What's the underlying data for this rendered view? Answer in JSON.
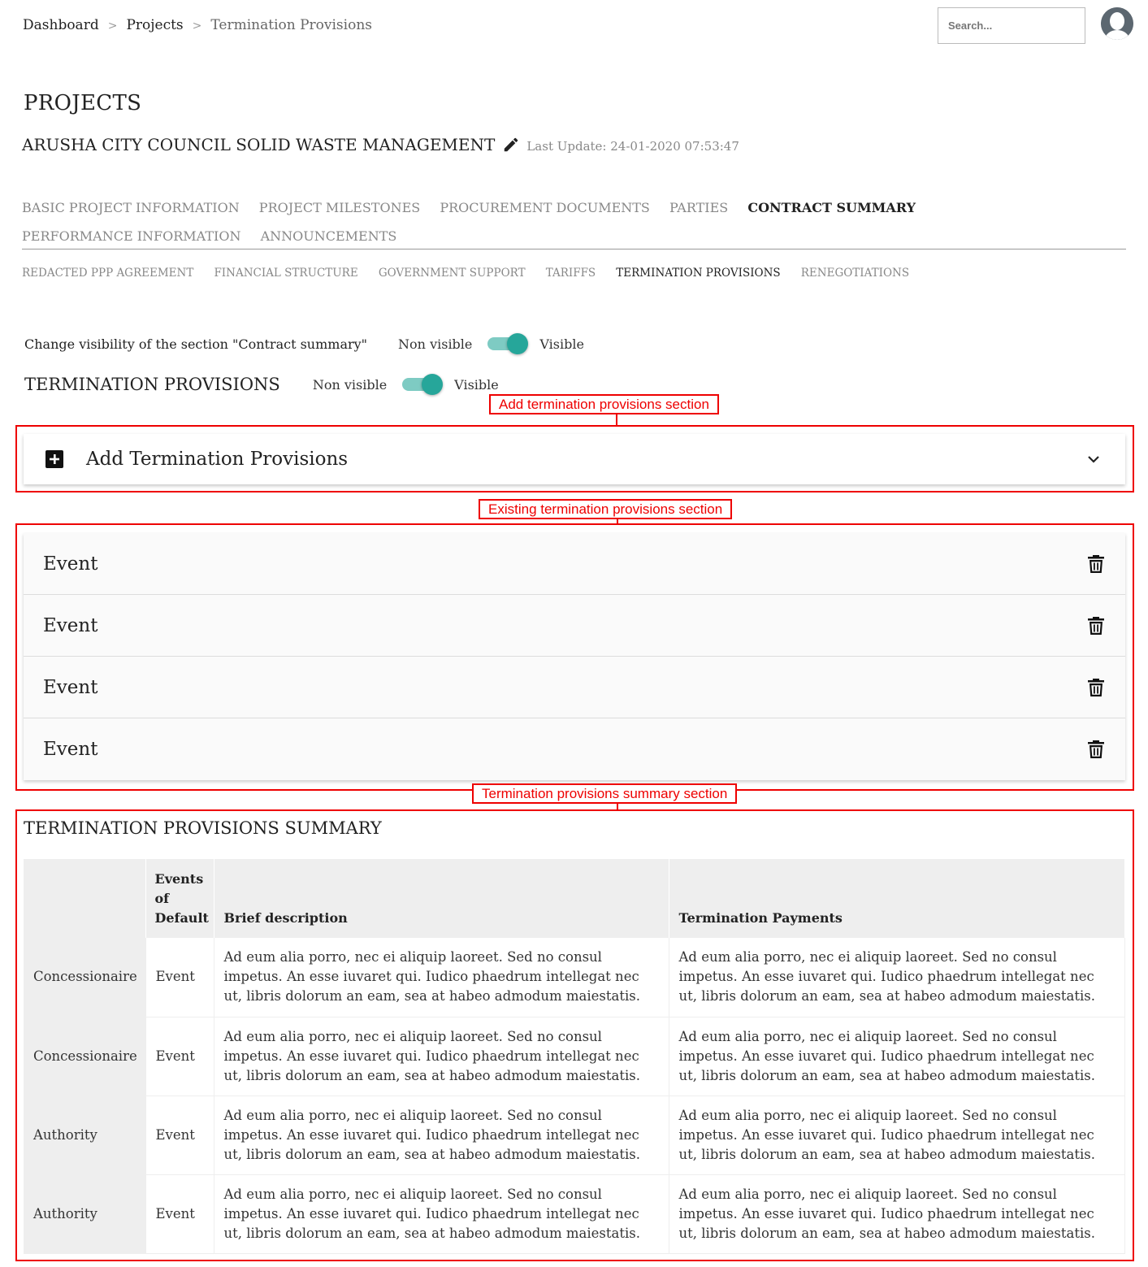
{
  "breadcrumb": {
    "items": [
      "Dashboard",
      "Projects",
      "Termination Provisions"
    ],
    "separator": ">"
  },
  "search": {
    "placeholder": "Search..."
  },
  "page": {
    "title": "PROJECTS",
    "project_name": "ARUSHA CITY COUNCIL SOLID WASTE MANAGEMENT",
    "last_update": "Last Update: 24-01-2020 07:53:47"
  },
  "main_tabs": [
    {
      "label": "BASIC PROJECT INFORMATION",
      "active": false
    },
    {
      "label": "PROJECT MILESTONES",
      "active": false
    },
    {
      "label": "PROCUREMENT DOCUMENTS",
      "active": false
    },
    {
      "label": "PARTIES",
      "active": false
    },
    {
      "label": "CONTRACT SUMMARY",
      "active": true
    },
    {
      "label": "PERFORMANCE INFORMATION",
      "active": false
    },
    {
      "label": "ANNOUNCEMENTS",
      "active": false
    }
  ],
  "sub_tabs": [
    {
      "label": "REDACTED PPP AGREEMENT",
      "active": false
    },
    {
      "label": "FINANCIAL STRUCTURE",
      "active": false
    },
    {
      "label": "GOVERNMENT SUPPORT",
      "active": false
    },
    {
      "label": "TARIFFS",
      "active": false
    },
    {
      "label": "TERMINATION PROVISIONS",
      "active": true
    },
    {
      "label": "RENEGOTIATIONS",
      "active": false
    }
  ],
  "visibility": {
    "label": "Change visibility of the section \"Contract summary\"",
    "off_label": "Non visible",
    "on_label": "Visible",
    "enabled": true
  },
  "section": {
    "title": "TERMINATION PROVISIONS",
    "off_label": "Non visible",
    "on_label": "Visible",
    "enabled": true
  },
  "annotations": {
    "add": "Add termination provisions section",
    "existing": "Existing termination provisions section",
    "summary": "Termination provisions summary section"
  },
  "add_panel": {
    "title": "Add Termination Provisions",
    "icon": "plus-square-icon",
    "chevron": "chevron-down-icon"
  },
  "events": [
    {
      "title": "Event"
    },
    {
      "title": "Event"
    },
    {
      "title": "Event"
    },
    {
      "title": "Event"
    }
  ],
  "summary": {
    "title": "TERMINATION PROVISIONS SUMMARY",
    "headers": [
      "",
      "Events of Default",
      "Brief description",
      "Termination Payments"
    ],
    "rows": [
      {
        "party": "Concessionaire",
        "event": "Event",
        "description": "Ad eum alia porro, nec ei aliquip laoreet. Sed no consul impetus. An esse iuvaret qui. Iudico phaedrum intellegat nec ut, libris dolorum an eam, sea at habeo admodum maiestatis.",
        "payments": "Ad eum alia porro, nec ei aliquip laoreet. Sed no consul impetus. An esse iuvaret qui. Iudico phaedrum intellegat nec ut, libris dolorum an eam, sea at habeo admodum maiestatis."
      },
      {
        "party": "Concessionaire",
        "event": "Event",
        "description": "Ad eum alia porro, nec ei aliquip laoreet. Sed no consul impetus. An esse iuvaret qui. Iudico phaedrum intellegat nec ut, libris dolorum an eam, sea at habeo admodum maiestatis.",
        "payments": "Ad eum alia porro, nec ei aliquip laoreet. Sed no consul impetus. An esse iuvaret qui. Iudico phaedrum intellegat nec ut, libris dolorum an eam, sea at habeo admodum maiestatis."
      },
      {
        "party": "Authority",
        "event": "Event",
        "description": "Ad eum alia porro, nec ei aliquip laoreet. Sed no consul impetus. An esse iuvaret qui. Iudico phaedrum intellegat nec ut, libris dolorum an eam, sea at habeo admodum maiestatis.",
        "payments": "Ad eum alia porro, nec ei aliquip laoreet. Sed no consul impetus. An esse iuvaret qui. Iudico phaedrum intellegat nec ut, libris dolorum an eam, sea at habeo admodum maiestatis."
      },
      {
        "party": "Authority",
        "event": "Event",
        "description": "Ad eum alia porro, nec ei aliquip laoreet. Sed no consul impetus. An esse iuvaret qui. Iudico phaedrum intellegat nec ut, libris dolorum an eam, sea at habeo admodum maiestatis.",
        "payments": "Ad eum alia porro, nec ei aliquip laoreet. Sed no consul impetus. An esse iuvaret qui. Iudico phaedrum intellegat nec ut, libris dolorum an eam, sea at habeo admodum maiestatis."
      }
    ]
  },
  "colors": {
    "accent": "#26a69a",
    "accent_track": "#7ecbc3",
    "annotation": "#e00000"
  }
}
